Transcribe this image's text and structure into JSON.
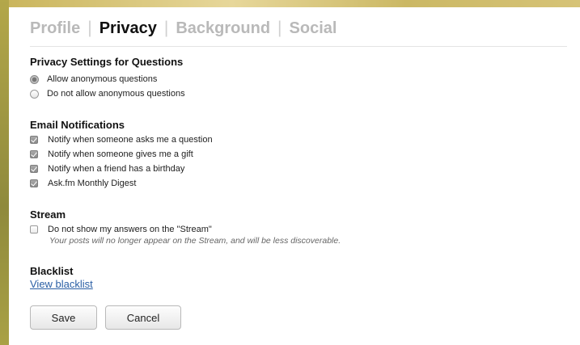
{
  "tabs": [
    {
      "label": "Profile",
      "active": false
    },
    {
      "label": "Privacy",
      "active": true
    },
    {
      "label": "Background",
      "active": false
    },
    {
      "label": "Social",
      "active": false
    }
  ],
  "questions": {
    "title": "Privacy Settings for Questions",
    "options": [
      {
        "label": "Allow anonymous questions",
        "selected": true
      },
      {
        "label": "Do not allow anonymous questions",
        "selected": false
      }
    ]
  },
  "email": {
    "title": "Email Notifications",
    "items": [
      {
        "label": "Notify when someone asks me a question",
        "checked": true
      },
      {
        "label": "Notify when someone gives me a gift",
        "checked": true
      },
      {
        "label": "Notify when a friend has a birthday",
        "checked": true
      },
      {
        "label": "Ask.fm Monthly Digest",
        "checked": true
      }
    ]
  },
  "stream": {
    "title": "Stream",
    "option_label": "Do not show my answers on the \"Stream\"",
    "checked": false,
    "hint": "Your posts will no longer appear on the Stream, and will be less discoverable."
  },
  "blacklist": {
    "title": "Blacklist",
    "link": "View blacklist"
  },
  "buttons": {
    "save": "Save",
    "cancel": "Cancel"
  },
  "colors": {
    "link": "#2a5fa5",
    "active_tab": "#111111",
    "inactive_tab": "#b9b9b9"
  }
}
